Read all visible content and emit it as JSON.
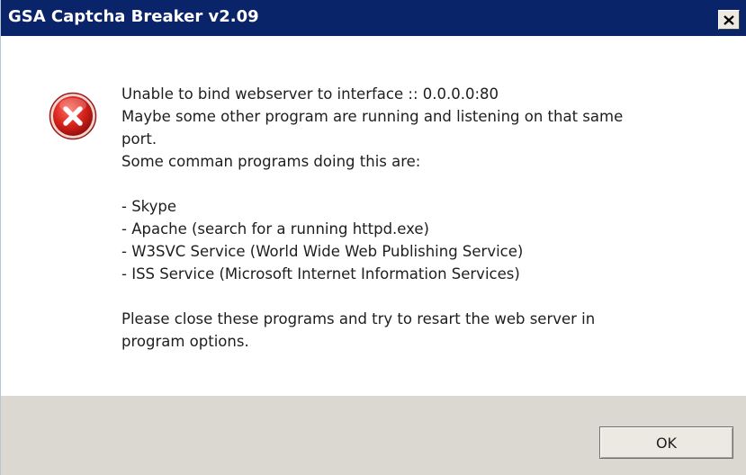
{
  "window": {
    "title": "GSA Captcha Breaker v2.09",
    "close_icon": "close-icon",
    "titlebar_color": "#0a246a"
  },
  "dialog": {
    "icon": "error-icon",
    "icon_color": "#c8102e",
    "lines": {
      "l1": "Unable to bind webserver to interface :: 0.0.0.0:80",
      "l2": "Maybe some other program are running and listening on that same",
      "l3": "port.",
      "l4": "Some comman programs doing this are:",
      "l5": "- Skype",
      "l6": "- Apache (search for a running httpd.exe)",
      "l7": "- W3SVC Service (World Wide Web Publishing Service)",
      "l8": "- ISS Service (Microsoft Internet Information Services)",
      "l9": "Please close these programs and try to resart the web server in",
      "l10": "program options."
    }
  },
  "footer": {
    "ok_label": "OK"
  }
}
